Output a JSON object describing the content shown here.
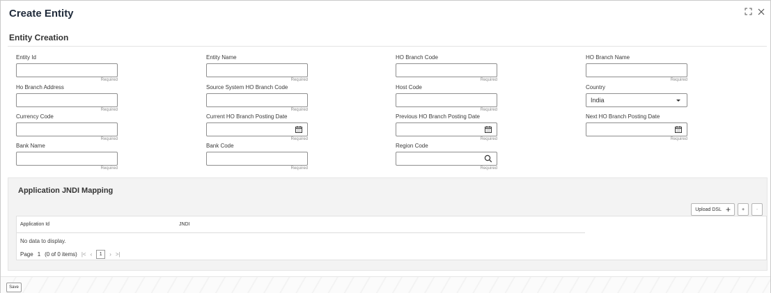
{
  "window": {
    "title": "Create Entity",
    "expand_icon": "expand-icon",
    "close_icon": "close-icon"
  },
  "section": {
    "title": "Entity Creation"
  },
  "fields": {
    "entity_id": {
      "label": "Entity Id",
      "value": "",
      "required": "Required"
    },
    "entity_name": {
      "label": "Entity Name",
      "value": "",
      "required": "Required"
    },
    "ho_branch_code": {
      "label": "HO Branch Code",
      "value": "",
      "required": "Required"
    },
    "ho_branch_name": {
      "label": "HO Branch Name",
      "value": "",
      "required": "Required"
    },
    "ho_branch_address": {
      "label": "Ho Branch Address",
      "value": "",
      "required": "Required"
    },
    "source_system_ho_branch_code": {
      "label": "Source System HO Branch Code",
      "value": "",
      "required": "Required"
    },
    "host_code": {
      "label": "Host Code",
      "value": "",
      "required": "Required"
    },
    "country": {
      "label": "Country",
      "value": "India"
    },
    "currency_code": {
      "label": "Currency Code",
      "value": "",
      "required": "Required"
    },
    "current_ho_branch_posting_date": {
      "label": "Current HO Branch Posting Date",
      "value": "",
      "required": "Required"
    },
    "previous_ho_branch_posting_date": {
      "label": "Previous HO Branch Posting Date",
      "value": "",
      "required": "Required"
    },
    "next_ho_branch_posting_date": {
      "label": "Next HO Branch Posting Date",
      "value": "",
      "required": "Required"
    },
    "bank_name": {
      "label": "Bank Name",
      "value": "",
      "required": "Required"
    },
    "bank_code": {
      "label": "Bank Code",
      "value": "",
      "required": "Required"
    },
    "region_code": {
      "label": "Region Code",
      "value": "",
      "required": "Required"
    }
  },
  "grid": {
    "title": "Application JNDI Mapping",
    "upload_label": "Upload DSL",
    "add_label": "+",
    "remove_label": "-",
    "columns": [
      "Application Id",
      "JNDI"
    ],
    "empty_text": "No data to display.",
    "pager": {
      "page_label": "Page",
      "page": "1",
      "items": "(0 of 0 items)",
      "first": "|<",
      "prev": "‹",
      "current": "1",
      "next": "›",
      "last": ">|"
    }
  },
  "footer": {
    "save_label": "Save"
  }
}
